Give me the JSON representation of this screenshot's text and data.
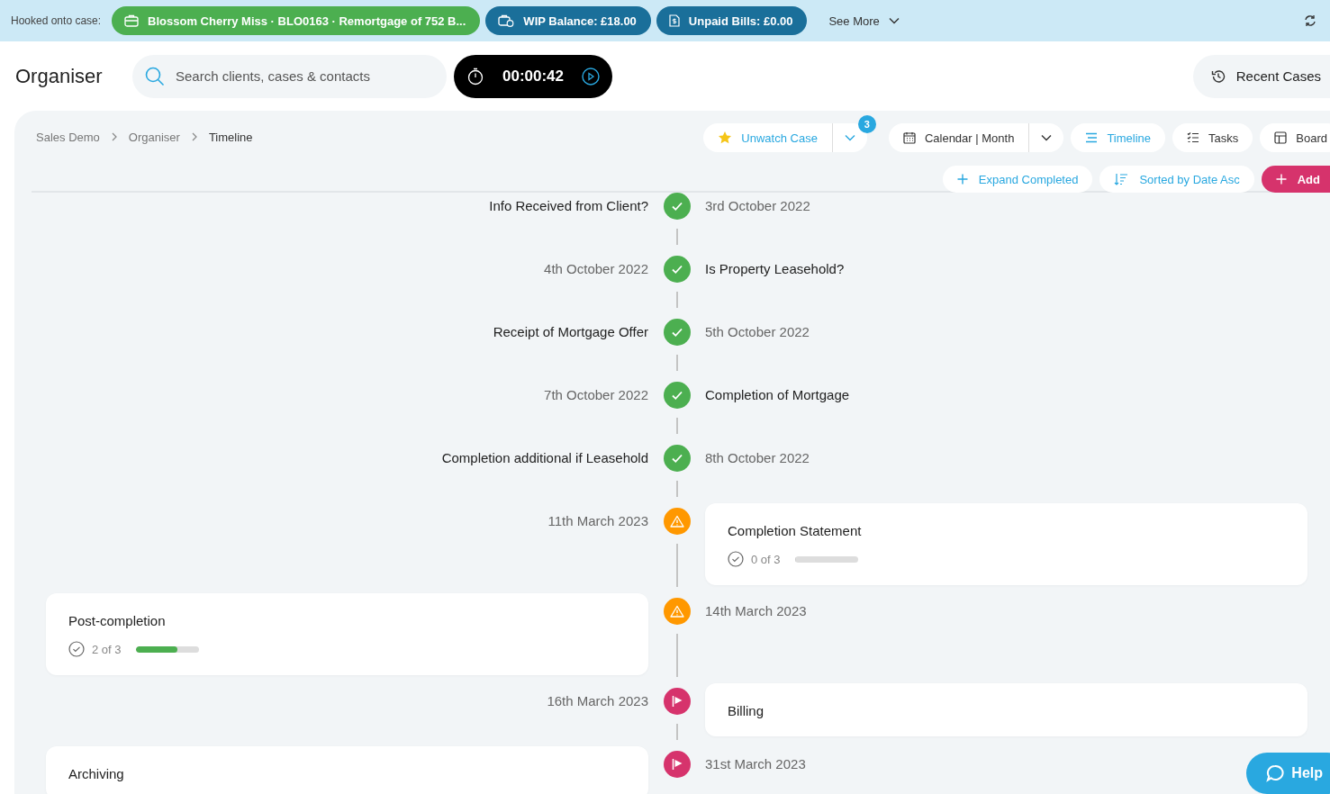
{
  "top_bar": {
    "label": "Hooked onto case:",
    "case_chip": "Blossom Cherry Miss · BLO0163 · Remortgage of 752 B...",
    "wip_chip": "WIP Balance: £18.00",
    "bills_chip": "Unpaid Bills: £0.00",
    "see_more": "See More"
  },
  "header": {
    "title": "Organiser",
    "search": {
      "placeholder": "Search clients, cases & contacts"
    },
    "timer": "00:00:42",
    "recent_cases": "Recent Cases"
  },
  "breadcrumb": [
    {
      "label": "Sales Demo",
      "current": false
    },
    {
      "label": "Organiser",
      "current": false
    },
    {
      "label": "Timeline",
      "current": true
    }
  ],
  "watch_button": {
    "label": "Unwatch Case",
    "badge": "3"
  },
  "views": [
    {
      "kind": "calendar",
      "label": "Calendar | Month",
      "selected": false,
      "dropdown": true
    },
    {
      "kind": "timeline",
      "label": "Timeline",
      "selected": true,
      "dropdown": false
    },
    {
      "kind": "tasks",
      "label": "Tasks",
      "selected": false,
      "dropdown": false
    },
    {
      "kind": "board",
      "label": "Board",
      "selected": false,
      "dropdown": false
    }
  ],
  "actions": [
    {
      "kind": "expand",
      "label": "Expand Completed"
    },
    {
      "kind": "sort",
      "label": "Sorted by Date Asc"
    },
    {
      "kind": "add",
      "label": "Add"
    }
  ],
  "timeline": [
    {
      "kind": "done",
      "title": "Info Received from Client?",
      "date": "3rd October 2022"
    },
    {
      "kind": "done",
      "title": "Is Property Leasehold?",
      "date": "4th October 2022"
    },
    {
      "kind": "done",
      "title": "Receipt of Mortgage Offer",
      "date": "5th October 2022"
    },
    {
      "kind": "done",
      "title": "Completion of Mortgage",
      "date": "7th October 2022"
    },
    {
      "kind": "done",
      "title": "Completion additional if Leasehold",
      "date": "8th October 2022"
    },
    {
      "kind": "warning",
      "title": "Completion Statement",
      "date": "11th March 2023",
      "progress": {
        "text": "0 of 3",
        "level": 0
      }
    },
    {
      "kind": "warning",
      "title": "Post-completion",
      "date": "14th March 2023",
      "progress": {
        "text": "2 of 3",
        "level": 0.67
      }
    },
    {
      "kind": "milestone",
      "title": "Billing",
      "date": "16th March 2023"
    },
    {
      "kind": "milestone",
      "title": "Archiving",
      "date": "31st March 2023"
    }
  ],
  "help": "Help"
}
